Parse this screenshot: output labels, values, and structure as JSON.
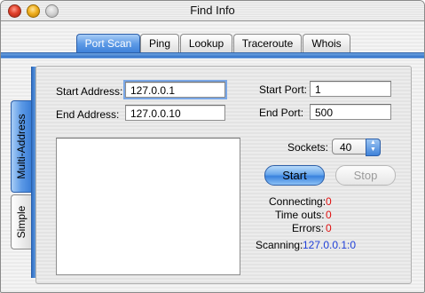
{
  "window": {
    "title": "Find Info"
  },
  "tabs": [
    {
      "label": "Port Scan",
      "active": true
    },
    {
      "label": "Ping",
      "active": false
    },
    {
      "label": "Lookup",
      "active": false
    },
    {
      "label": "Traceroute",
      "active": false
    },
    {
      "label": "Whois",
      "active": false
    }
  ],
  "side_tabs": [
    {
      "label": "Multi-Address",
      "active": true
    },
    {
      "label": "Simple",
      "active": false
    }
  ],
  "form": {
    "start_address_label": "Start Address:",
    "start_address_value": "127.0.0.1",
    "end_address_label": "End Address:",
    "end_address_value": "127.0.0.10",
    "start_port_label": "Start Port:",
    "start_port_value": "1",
    "end_port_label": "End Port:",
    "end_port_value": "500",
    "sockets_label": "Sockets:",
    "sockets_value": "40"
  },
  "buttons": {
    "start": "Start",
    "stop": "Stop"
  },
  "status": {
    "connecting_label": "Connecting:",
    "connecting_value": "0",
    "timeouts_label": "Time outs:",
    "timeouts_value": "0",
    "errors_label": "Errors:",
    "errors_value": "0",
    "scanning_label": "Scanning:",
    "scanning_value": "127.0.0.1:0"
  },
  "colors": {
    "accent": "#3b7fd8",
    "error_value": "#e01010",
    "scanning_value": "#1f3fd8"
  }
}
